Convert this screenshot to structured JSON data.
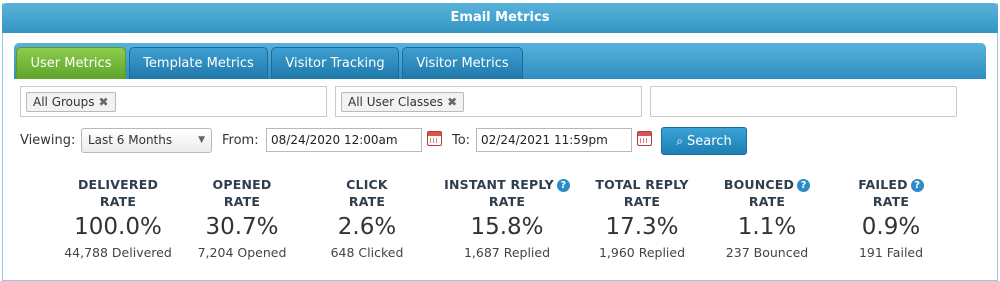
{
  "window": {
    "title": "Email Metrics"
  },
  "tabs": [
    {
      "label": "User Metrics",
      "active": true
    },
    {
      "label": "Template Metrics",
      "active": false
    },
    {
      "label": "Visitor Tracking",
      "active": false
    },
    {
      "label": "Visitor Metrics",
      "active": false
    }
  ],
  "filters": {
    "groups_tag": "All Groups",
    "classes_tag": "All User Classes",
    "remove_glyph": "✖",
    "third_input_value": ""
  },
  "date_range": {
    "viewing_label": "Viewing:",
    "viewing_value": "Last 6 Months",
    "from_label": "From:",
    "from_value": "08/24/2020 12:00am",
    "to_label": "To:",
    "to_value": "02/24/2021 11:59pm",
    "search_label": "Search"
  },
  "metrics": [
    {
      "head1": "DELIVERED",
      "head2": "RATE",
      "value": "100.0%",
      "sub": "44,788 Delivered",
      "help": false
    },
    {
      "head1": "OPENED",
      "head2": "RATE",
      "value": "30.7%",
      "sub": "7,204 Opened",
      "help": false
    },
    {
      "head1": "CLICK",
      "head2": "RATE",
      "value": "2.6%",
      "sub": "648 Clicked",
      "help": false
    },
    {
      "head1": "INSTANT REPLY",
      "head2": "RATE",
      "value": "15.8%",
      "sub": "1,687 Replied",
      "help": true
    },
    {
      "head1": "TOTAL REPLY",
      "head2": "RATE",
      "value": "17.3%",
      "sub": "1,960 Replied",
      "help": false
    },
    {
      "head1": "BOUNCED",
      "head2": "RATE",
      "value": "1.1%",
      "sub": "237 Bounced",
      "help": true
    },
    {
      "head1": "FAILED",
      "head2": "RATE",
      "value": "0.9%",
      "sub": "191 Failed",
      "help": true
    }
  ],
  "colors": {
    "accent": "#3496c4",
    "active_tab": "#6cb33f",
    "help_icon": "#2d8bc7"
  }
}
